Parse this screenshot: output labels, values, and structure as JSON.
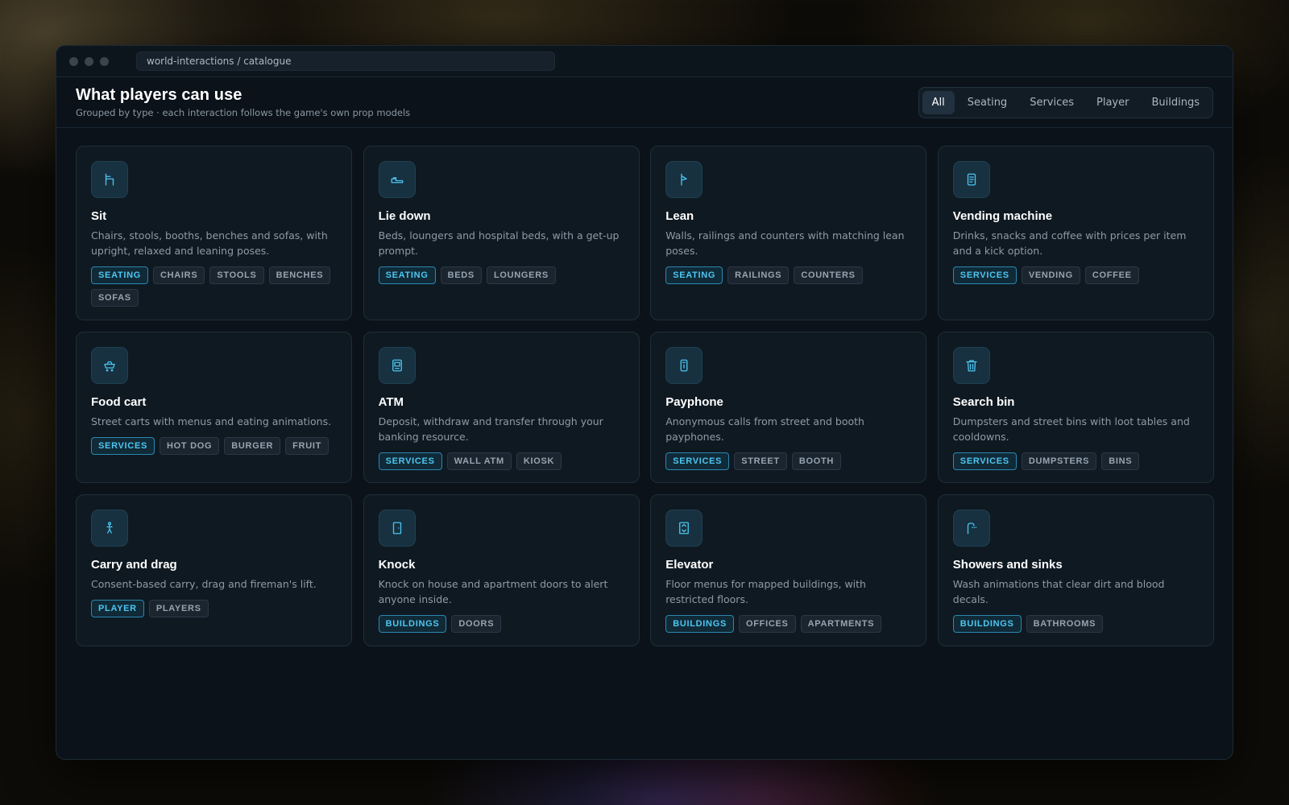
{
  "window": {
    "address": "world-interactions / catalogue"
  },
  "header": {
    "title": "What players can use",
    "subtitle": "Grouped by type · each interaction follows the game's own prop models"
  },
  "filters": [
    "All",
    "Seating",
    "Services",
    "Player",
    "Buildings"
  ],
  "active_filter": "All",
  "colors": {
    "accent": "#4cc3ef",
    "window_bg": "#0b1219",
    "card_bg": "#0f1921"
  },
  "cards": [
    {
      "icon": "chair-icon",
      "title": "Sit",
      "desc": "Chairs, stools, booths, benches and sofas, with upright, relaxed and leaning poses.",
      "tags": [
        "SEATING",
        "CHAIRS",
        "STOOLS",
        "BENCHES",
        "SOFAS"
      ]
    },
    {
      "icon": "bed-icon",
      "title": "Lie down",
      "desc": "Beds, loungers and hospital beds, with a get-up prompt.",
      "tags": [
        "SEATING",
        "BEDS",
        "LOUNGERS"
      ]
    },
    {
      "icon": "lean-icon",
      "title": "Lean",
      "desc": "Walls, railings and counters with matching lean poses.",
      "tags": [
        "SEATING",
        "RAILINGS",
        "COUNTERS"
      ]
    },
    {
      "icon": "vending-machine-icon",
      "title": "Vending machine",
      "desc": "Drinks, snacks and coffee with prices per item and a kick option.",
      "tags": [
        "SERVICES",
        "VENDING",
        "COFFEE"
      ]
    },
    {
      "icon": "food-cart-icon",
      "title": "Food cart",
      "desc": "Street carts with menus and eating animations.",
      "tags": [
        "SERVICES",
        "HOT DOG",
        "BURGER",
        "FRUIT"
      ]
    },
    {
      "icon": "atm-icon",
      "title": "ATM",
      "desc": "Deposit, withdraw and transfer through your banking resource.",
      "tags": [
        "SERVICES",
        "WALL ATM",
        "KIOSK"
      ]
    },
    {
      "icon": "payphone-icon",
      "title": "Payphone",
      "desc": "Anonymous calls from street and booth payphones.",
      "tags": [
        "SERVICES",
        "STREET",
        "BOOTH"
      ]
    },
    {
      "icon": "trash-bin-icon",
      "title": "Search bin",
      "desc": "Dumpsters and street bins with loot tables and cooldowns.",
      "tags": [
        "SERVICES",
        "DUMPSTERS",
        "BINS"
      ]
    },
    {
      "icon": "person-carry-icon",
      "title": "Carry and drag",
      "desc": "Consent-based carry, drag and fireman's lift.",
      "tags": [
        "PLAYER",
        "PLAYERS"
      ]
    },
    {
      "icon": "door-icon",
      "title": "Knock",
      "desc": "Knock on house and apartment doors to alert anyone inside.",
      "tags": [
        "BUILDINGS",
        "DOORS"
      ]
    },
    {
      "icon": "elevator-icon",
      "title": "Elevator",
      "desc": "Floor menus for mapped buildings, with restricted floors.",
      "tags": [
        "BUILDINGS",
        "OFFICES",
        "APARTMENTS"
      ]
    },
    {
      "icon": "shower-icon",
      "title": "Showers and sinks",
      "desc": "Wash animations that clear dirt and blood decals.",
      "tags": [
        "BUILDINGS",
        "BATHROOMS"
      ]
    }
  ]
}
